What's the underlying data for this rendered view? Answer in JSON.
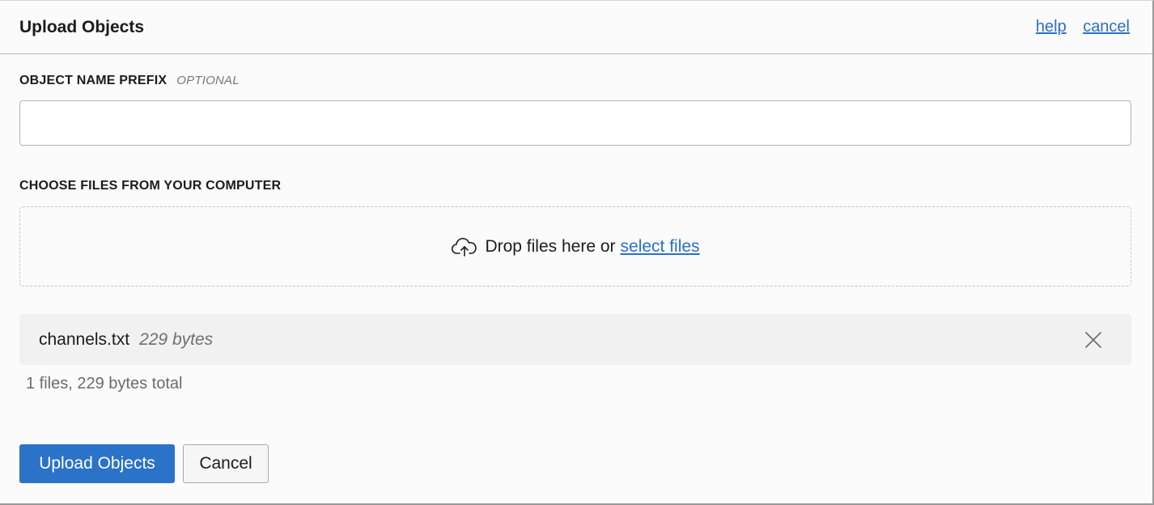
{
  "header": {
    "title": "Upload Objects",
    "help_label": "help",
    "cancel_label": "cancel"
  },
  "prefix": {
    "label": "OBJECT NAME PREFIX",
    "optional_label": "OPTIONAL",
    "value": ""
  },
  "choose": {
    "label": "CHOOSE FILES FROM YOUR COMPUTER",
    "drop_text": "Drop files here or",
    "select_link": "select files",
    "icon": "cloud-upload-icon"
  },
  "files": [
    {
      "name": "channels.txt",
      "size": "229 bytes"
    }
  ],
  "summary": "1 files, 229 bytes total",
  "footer": {
    "upload_label": "Upload Objects",
    "cancel_label": "Cancel"
  },
  "colors": {
    "accent": "#2b72c9",
    "link": "#2a6fc7"
  }
}
